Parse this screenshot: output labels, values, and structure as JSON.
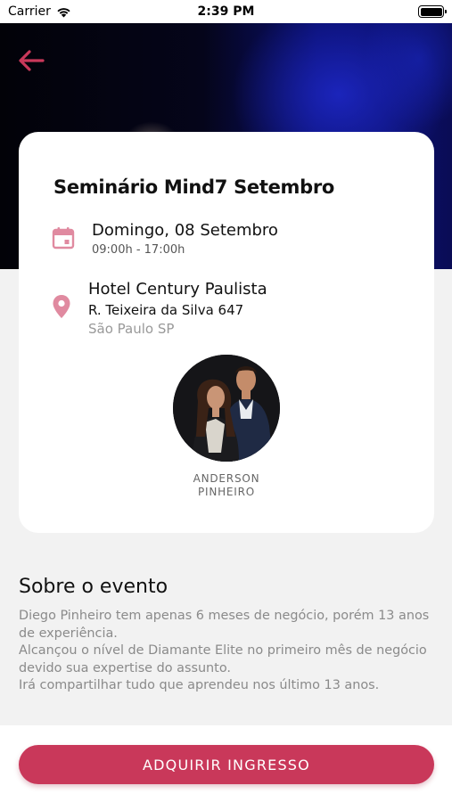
{
  "status_bar": {
    "carrier": "Carrier",
    "time": "2:39 PM"
  },
  "colors": {
    "accent": "#c9385a",
    "icon_pink": "#e08aa0"
  },
  "event": {
    "title": "Seminário Mind7 Setembro",
    "date": "Domingo, 08 Setembro",
    "time": "09:00h - 17:00h",
    "location_name": "Hotel Century Paulista",
    "street": "R. Teixeira da Silva 647",
    "city": "São Paulo SP"
  },
  "speaker": {
    "name_line1": "ANDERSON",
    "name_line2": "PINHEIRO"
  },
  "about": {
    "title": "Sobre o evento",
    "paragraphs": [
      "Diego Pinheiro tem apenas 6 meses de negócio, porém 13 anos de experiência.",
      "Alcançou o nível de Diamante Elite no primeiro mês de negócio devido sua expertise do assunto.",
      "Irá compartilhar tudo que aprendeu nos último 13 anos."
    ]
  },
  "cta": {
    "label": "ADQUIRIR INGRESSO"
  },
  "icons": [
    "back-arrow-icon",
    "calendar-icon",
    "location-pin-icon",
    "wifi-icon",
    "battery-icon"
  ]
}
